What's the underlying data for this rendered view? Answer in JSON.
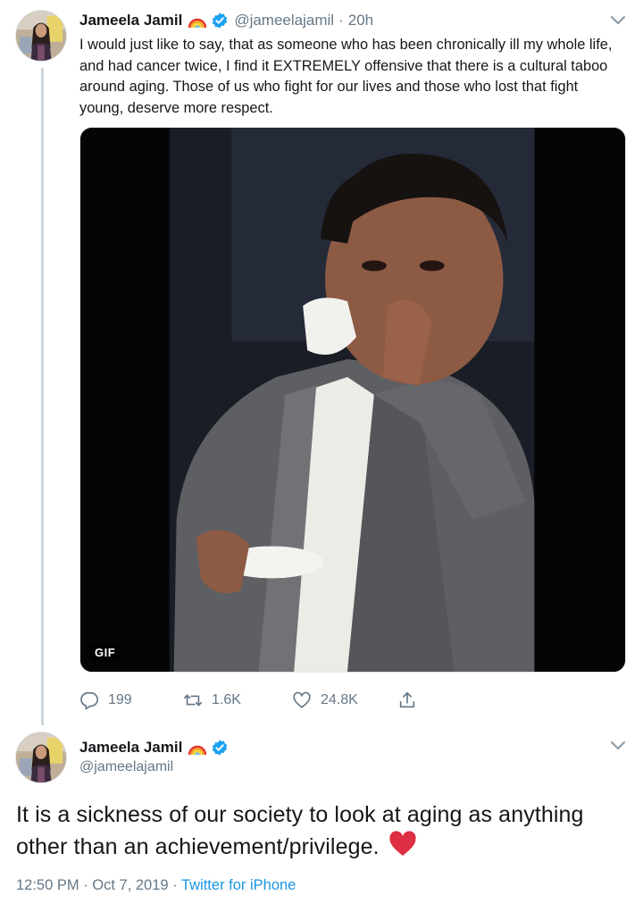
{
  "tweet1": {
    "author_name": "Jameela Jamil",
    "handle": "@jameelajamil",
    "separator": "·",
    "time": "20h",
    "text": "I would just like to say, that as someone who has been chronically ill my whole life, and had cancer twice, I find it EXTREMELY offensive that there is a cultural taboo around aging. Those of us who fight for our lives and those who lost that fight young, deserve more respect.",
    "media_badge": "GIF",
    "replies": "199",
    "retweets": "1.6K",
    "likes": "24.8K",
    "icons": {
      "reply": "reply-icon",
      "retweet": "retweet-icon",
      "like": "heart-outline-icon",
      "share": "share-icon",
      "menu": "chevron-down-icon",
      "verified": "verified-badge-icon",
      "emoji": "rainbow-emoji-icon"
    }
  },
  "tweet2": {
    "author_name": "Jameela Jamil",
    "handle": "@jameelajamil",
    "text": "It is a sickness of our society to look at aging as anything other than an achievement/privilege.",
    "emoji": "red-heart-emoji",
    "timestamp": "12:50 PM · Oct 7, 2019",
    "separator": " · ",
    "source": "Twitter for iPhone"
  },
  "colors": {
    "text_primary": "#14171a",
    "text_secondary": "#657786",
    "link": "#1b95e0",
    "verified": "#1da1f2",
    "thread_line": "#ccd6dd",
    "heart_red": "#dd2e44"
  }
}
